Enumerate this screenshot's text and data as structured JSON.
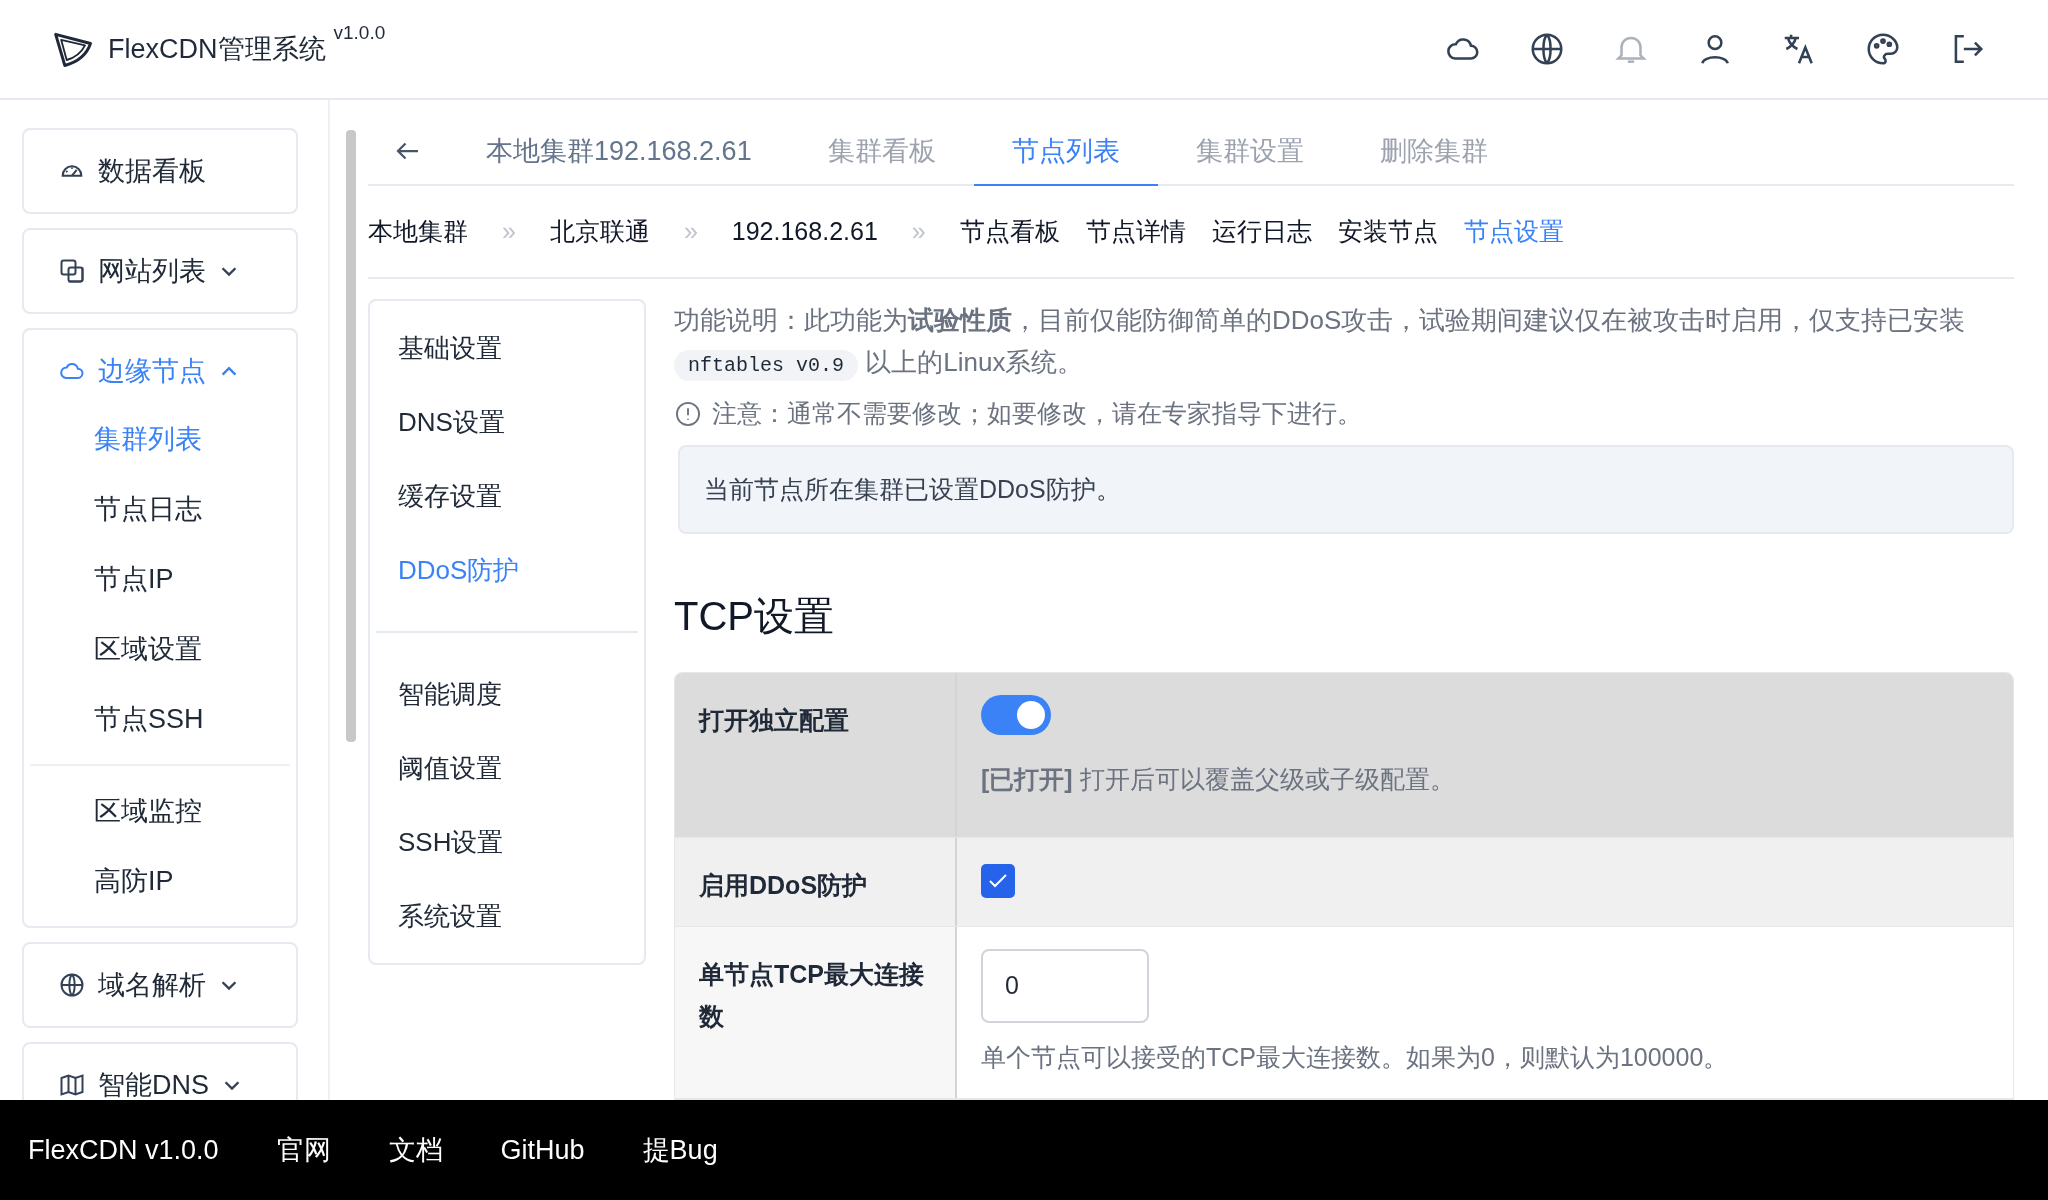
{
  "header": {
    "title": "FlexCDN管理系统",
    "version": "v1.0.0"
  },
  "sidebar": {
    "items": [
      {
        "label": "数据看板",
        "kind": "link",
        "selected": false
      },
      {
        "label": "网站列表",
        "kind": "group",
        "selected": false,
        "expanded": false
      },
      {
        "label": "边缘节点",
        "kind": "group",
        "selected": true,
        "expanded": true,
        "children": [
          {
            "label": "集群列表",
            "selected": true,
            "divider_before": false
          },
          {
            "label": "节点日志",
            "selected": false,
            "divider_before": false
          },
          {
            "label": "节点IP",
            "selected": false,
            "divider_before": false
          },
          {
            "label": "区域设置",
            "selected": false,
            "divider_before": false
          },
          {
            "label": "节点SSH",
            "selected": false,
            "divider_before": false
          },
          {
            "label": "区域监控",
            "selected": false,
            "divider_before": true
          },
          {
            "label": "高防IP",
            "selected": false,
            "divider_before": false
          }
        ]
      },
      {
        "label": "域名解析",
        "kind": "group",
        "selected": false,
        "expanded": false
      },
      {
        "label": "智能DNS",
        "kind": "group",
        "selected": false,
        "expanded": false
      }
    ]
  },
  "tabs": [
    {
      "label": "本地集群192.168.2.61",
      "kind": "title",
      "selected": false
    },
    {
      "label": "集群看板",
      "kind": "tab",
      "selected": false
    },
    {
      "label": "节点列表",
      "kind": "tab",
      "selected": true
    },
    {
      "label": "集群设置",
      "kind": "tab",
      "selected": false
    },
    {
      "label": "删除集群",
      "kind": "tab",
      "selected": false
    }
  ],
  "breadcrumb": [
    {
      "label": "本地集群",
      "kind": "crumb"
    },
    {
      "label": "»",
      "kind": "separator"
    },
    {
      "label": "北京联通",
      "kind": "crumb"
    },
    {
      "label": "»",
      "kind": "separator"
    },
    {
      "label": "192.168.2.61",
      "kind": "crumb"
    },
    {
      "label": "»",
      "kind": "separator"
    },
    {
      "label": "节点看板",
      "kind": "link",
      "selected": false
    },
    {
      "label": "节点详情",
      "kind": "link",
      "selected": false
    },
    {
      "label": "运行日志",
      "kind": "link",
      "selected": false
    },
    {
      "label": "安装节点",
      "kind": "link",
      "selected": false
    },
    {
      "label": "节点设置",
      "kind": "link",
      "selected": true
    }
  ],
  "settings_menu": [
    [
      {
        "label": "基础设置",
        "selected": false
      },
      {
        "label": "DNS设置",
        "selected": false
      },
      {
        "label": "缓存设置",
        "selected": false
      },
      {
        "label": "DDoS防护",
        "selected": true
      }
    ],
    [
      {
        "label": "智能调度",
        "selected": false
      },
      {
        "label": "阈值设置",
        "selected": false
      },
      {
        "label": "SSH设置",
        "selected": false
      },
      {
        "label": "系统设置",
        "selected": false
      }
    ]
  ],
  "description": {
    "text_1": "功能说明：此功能为**试验性质**，目前仅能防御简单的DDoS攻击，试验期间建议仅在被攻击时启用，仅支持已安装",
    "code": "nftables v0.9",
    "text_2": "以上的Linux系统。"
  },
  "warning": "注意：通常不需要修改；如要修改，请在专家指导下进行。",
  "message": "当前节点所在集群已设置DDoS防护。",
  "section_title": "TCP设置",
  "form": [
    {
      "kind": "toggle",
      "label": "打开独立配置",
      "on": true,
      "status_text": "[已打开]",
      "hint": "打开后可以覆盖父级或子级配置。"
    },
    {
      "kind": "checkbox",
      "label": "启用DDoS防护",
      "checked": true
    },
    {
      "kind": "number",
      "label": "单节点TCP最大连接数",
      "value": "0",
      "hint": "单个节点可以接受的TCP最大连接数。如果为0，则默认为100000。"
    }
  ],
  "footer": [
    "FlexCDN v1.0.0",
    "官网",
    "文档",
    "GitHub",
    "提Bug"
  ]
}
